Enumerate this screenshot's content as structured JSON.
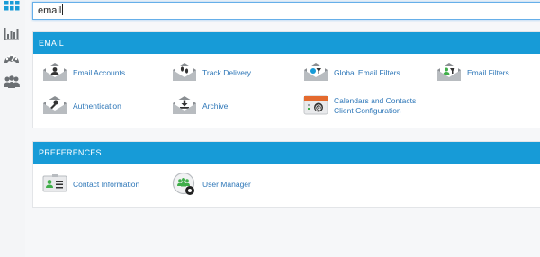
{
  "search": {
    "value": "email"
  },
  "sidebar": {
    "items": [
      {
        "icon": "grid-icon",
        "active": true
      },
      {
        "icon": "bar-chart-icon"
      },
      {
        "icon": "dashboard-icon"
      },
      {
        "icon": "users-icon"
      }
    ]
  },
  "email_section": {
    "header": "EMAIL",
    "items": [
      {
        "label": "Email Accounts",
        "icon": "envelope-person-icon"
      },
      {
        "label": "Track Delivery",
        "icon": "envelope-footprints-icon"
      },
      {
        "label": "Global Email Filters",
        "icon": "envelope-globe-filter-icon"
      },
      {
        "label": "Email Filters",
        "icon": "envelope-person-filter-icon"
      },
      {
        "label": "Authentication",
        "icon": "envelope-key-icon"
      },
      {
        "label": "Archive",
        "icon": "envelope-download-icon"
      },
      {
        "label_line1": "Calendars and Contacts",
        "label_line2": "Client Configuration",
        "icon": "calendar-at-icon"
      }
    ]
  },
  "preferences_section": {
    "header": "PREFERENCES",
    "items": [
      {
        "label": "Contact Information",
        "icon": "contact-card-icon"
      },
      {
        "label": "User Manager",
        "icon": "user-manager-icon"
      }
    ]
  },
  "colors": {
    "accent": "#179bd7",
    "link": "#2e77b8",
    "icon_gray": "#6b6f73",
    "icon_green": "#3fae49"
  }
}
